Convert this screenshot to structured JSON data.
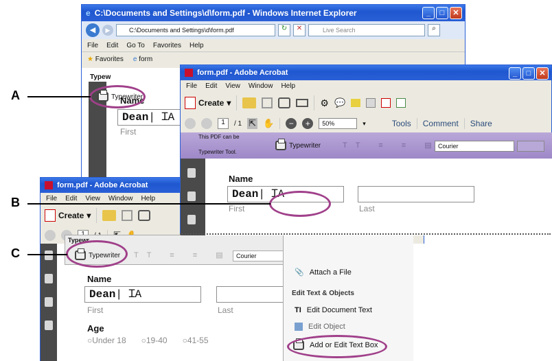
{
  "ie": {
    "title": "C:\\Documents and Settings\\d\\form.pdf - Windows Internet Explorer",
    "address": "C:\\Documents and Settings\\d\\form.pdf",
    "search_placeholder": "Live Search",
    "menu": [
      "File",
      "Edit",
      "Go To",
      "Favorites",
      "Help"
    ],
    "favorites_label": "Favorites",
    "tab_label": "form",
    "panel_label": "Typew",
    "form_name_label": "Name",
    "form_first_value": "Dean",
    "form_first_label": "First"
  },
  "acrobat1": {
    "title": "form.pdf - Adobe Acrobat",
    "menu": [
      "File",
      "Edit",
      "View",
      "Window",
      "Help"
    ],
    "create_label": "Create",
    "page_num": "1",
    "page_total": "/ 1",
    "zoom": "50%",
    "tabs": [
      "Tools",
      "Comment",
      "Share"
    ],
    "notice_line1": "This PDF can be",
    "notice_line2": "Typewriter Tool.",
    "typewriter_label": "Typewriter",
    "font_value": "Courier",
    "name_label": "Name",
    "first_value": "Dean",
    "first_label": "First",
    "last_label": "Last"
  },
  "acrobat2": {
    "title": "form.pdf - Adobe Acrobat",
    "menu": [
      "File",
      "Edit",
      "View",
      "Window",
      "Help"
    ],
    "create_label": "Create",
    "page_num": "1",
    "page_total": "/ 1",
    "panel_title": "Typewr",
    "typewriter_label": "Typewriter",
    "font_value": "Courier",
    "name_label": "Name",
    "first_value": "Dean",
    "first_label": "First",
    "last_label": "Last",
    "age_label": "Age",
    "age_options": [
      "Under 18",
      "19-40",
      "41-55"
    ]
  },
  "tools_panel": {
    "attach_label": "Attach a File",
    "section_label": "Edit Text & Objects",
    "edit_doc_text": "Edit Document Text",
    "edit_object": "Edit Object",
    "add_text_box": "Add or Edit Text Box"
  },
  "callouts": [
    "A",
    "B",
    "C"
  ],
  "colors": {
    "callout": "#a0408a",
    "xp_blue": "#2a5fd6",
    "rail": "#4a4a4a",
    "purple_bar": "#9e88c8"
  }
}
